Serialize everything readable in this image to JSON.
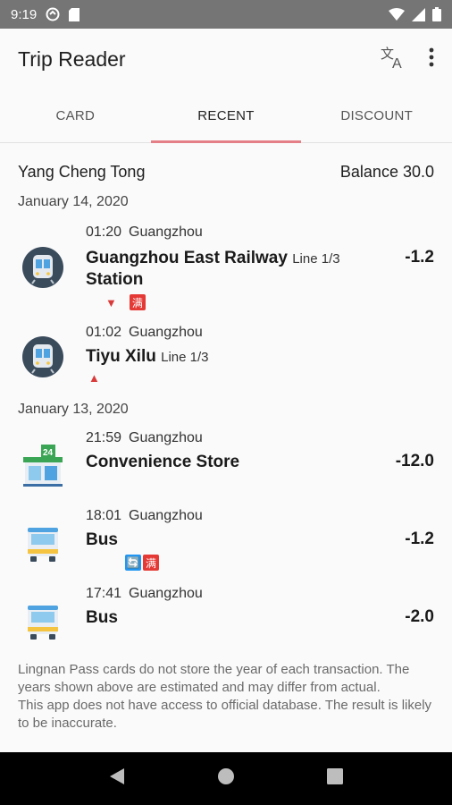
{
  "status_bar": {
    "time": "9:19"
  },
  "app": {
    "title": "Trip Reader"
  },
  "tabs": [
    {
      "label": "CARD"
    },
    {
      "label": "RECENT"
    },
    {
      "label": "DISCOUNT"
    }
  ],
  "card": {
    "name": "Yang Cheng Tong",
    "balance": "Balance 30.0"
  },
  "groups": [
    {
      "date": "January 14, 2020",
      "entries": [
        {
          "time": "01:20",
          "city": "Guangzhou",
          "station_line1": "Guangzhou East Railway",
          "line": "Line 1/3",
          "station_line2": "Station",
          "amount": "-1.2",
          "icon": "metro-icon"
        },
        {
          "time": "01:02",
          "city": "Guangzhou",
          "station_line1": "Tiyu Xilu",
          "line": "Line 1/3",
          "amount": "",
          "icon": "metro-icon"
        }
      ]
    },
    {
      "date": "January 13, 2020",
      "entries": [
        {
          "time": "21:59",
          "city": "Guangzhou",
          "station_line1": "Convenience Store",
          "amount": "-12.0",
          "icon": "convenience-store-icon"
        },
        {
          "time": "18:01",
          "city": "Guangzhou",
          "station_line1": "Bus",
          "amount": "-1.2",
          "icon": "bus-icon"
        },
        {
          "time": "17:41",
          "city": "Guangzhou",
          "station_line1": "Bus",
          "amount": "-2.0",
          "icon": "bus-icon"
        }
      ]
    }
  ],
  "badges": {
    "man": "满",
    "transfer": "🔄",
    "store_24": "24"
  },
  "footnote": {
    "line1": "Lingnan Pass cards do not store the year of each transaction. The years shown above are estimated and may differ from actual.",
    "line2": "This app does not have access to official database. The result is likely to be inaccurate."
  },
  "colors": {
    "tab_indicator": "#e57f87",
    "badge_red": "#e53935",
    "badge_blue": "#2196f3",
    "status_bar": "#757575"
  }
}
